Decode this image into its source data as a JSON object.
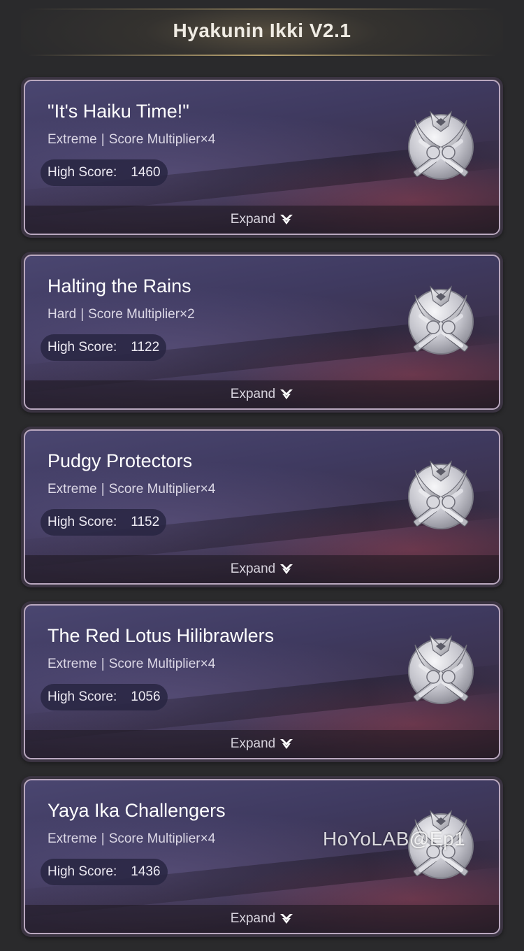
{
  "header": {
    "title": "Hyakunin Ikki V2.1"
  },
  "cards": [
    {
      "title": "\"It's Haiku Time!\"",
      "difficulty": "Extreme",
      "separator": "|",
      "multiplier": "Score Multiplier×4",
      "score_label": "High Score:",
      "score_value": "1460",
      "expand_label": "Expand",
      "emblem_icon": "silver-crossed-swords-emblem-icon"
    },
    {
      "title": "Halting the Rains",
      "difficulty": "Hard",
      "separator": "|",
      "multiplier": "Score Multiplier×2",
      "score_label": "High Score:",
      "score_value": "1122",
      "expand_label": "Expand",
      "emblem_icon": "silver-crossed-swords-emblem-icon"
    },
    {
      "title": "Pudgy Protectors",
      "difficulty": "Extreme",
      "separator": "|",
      "multiplier": "Score Multiplier×4",
      "score_label": "High Score:",
      "score_value": "1152",
      "expand_label": "Expand",
      "emblem_icon": "silver-crossed-swords-emblem-icon"
    },
    {
      "title": "The Red Lotus Hilibrawlers",
      "difficulty": "Extreme",
      "separator": "|",
      "multiplier": "Score Multiplier×4",
      "score_label": "High Score:",
      "score_value": "1056",
      "expand_label": "Expand",
      "emblem_icon": "silver-crossed-swords-emblem-icon"
    },
    {
      "title": "Yaya Ika Challengers",
      "difficulty": "Extreme",
      "separator": "|",
      "multiplier": "Score Multiplier×4",
      "score_label": "High Score:",
      "score_value": "1436",
      "expand_label": "Expand",
      "emblem_icon": "silver-crossed-swords-emblem-icon"
    }
  ],
  "watermark": "HoYoLAB@Ep1",
  "colors": {
    "page_background": "#2a2a2c",
    "card_border": "#b9a8bf",
    "card_gradient_top": "#4a4670",
    "card_gradient_bottom": "#2d2331",
    "header_gold": "#c8b078"
  }
}
